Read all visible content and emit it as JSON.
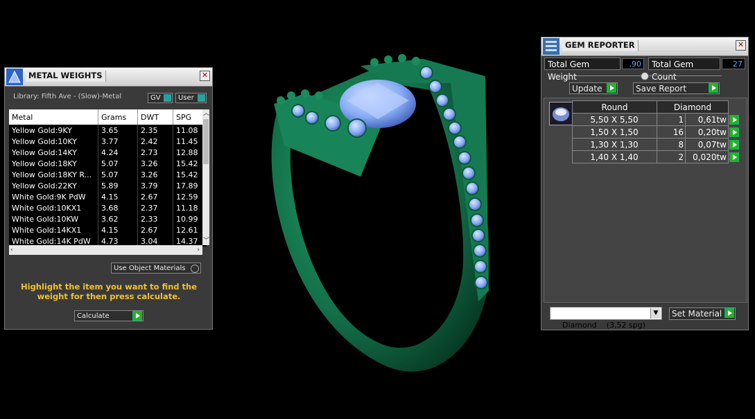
{
  "metal_panel": {
    "title": "METAL WEIGHTS",
    "library": "Library: Fifth Ave - (Slow)-Metal",
    "gv_label": "GV",
    "user_label": "User",
    "columns": [
      "Metal",
      "Grams",
      "DWT",
      "SPG"
    ],
    "rows": [
      [
        "Yellow Gold:9KY",
        "3.65",
        "2.35",
        "11.08"
      ],
      [
        "Yellow Gold:10KY",
        "3.77",
        "2.42",
        "11.45"
      ],
      [
        "Yellow Gold:14KY",
        "4.24",
        "2.73",
        "12.88"
      ],
      [
        "Yellow Gold:18KY",
        "5.07",
        "3.26",
        "15.42"
      ],
      [
        "Yellow Gold:18KY R...",
        "5.07",
        "3.26",
        "15.42"
      ],
      [
        "Yellow Gold:22KY",
        "5.89",
        "3.79",
        "17.89"
      ],
      [
        "White Gold:9K PdW",
        "4.15",
        "2.67",
        "12.59"
      ],
      [
        "White Gold:10KX1",
        "3.68",
        "2.37",
        "11.18"
      ],
      [
        "White Gold:10KW",
        "3.62",
        "2.33",
        "10.99"
      ],
      [
        "White Gold:14KX1",
        "4.15",
        "2.67",
        "12.61"
      ],
      [
        "White Gold:14K PdW",
        "4.73",
        "3.04",
        "14.37"
      ]
    ],
    "use_object_materials": "Use Object Materials",
    "instruction": "Highlight the item you want to find the weight for then press calculate.",
    "calculate_label": "Calculate"
  },
  "gem_panel": {
    "title": "GEM REPORTER",
    "total_weight_label": "Total Gem Weight",
    "total_weight_value": ",90",
    "total_count_label": "Total Gem Count",
    "total_count_value": "27",
    "update_label": "Update",
    "save_report_label": "Save Report",
    "shape_header": "Round",
    "material_header": "Diamond",
    "rows": [
      [
        "5,50 X 5,50",
        "1",
        "0,61tw"
      ],
      [
        "1,50 X 1,50",
        "16",
        "0,20tw"
      ],
      [
        "1,30 X 1,30",
        "8",
        "0,07tw"
      ],
      [
        "1,40 X 1,40",
        "2",
        "0,020tw"
      ]
    ],
    "material_select": "Diamond    (3,52 spg)",
    "set_material_label": "Set Material"
  },
  "colors": {
    "ring": "#14704a",
    "gem": "#8fb4ff",
    "accent_yellow": "#f2c230"
  }
}
